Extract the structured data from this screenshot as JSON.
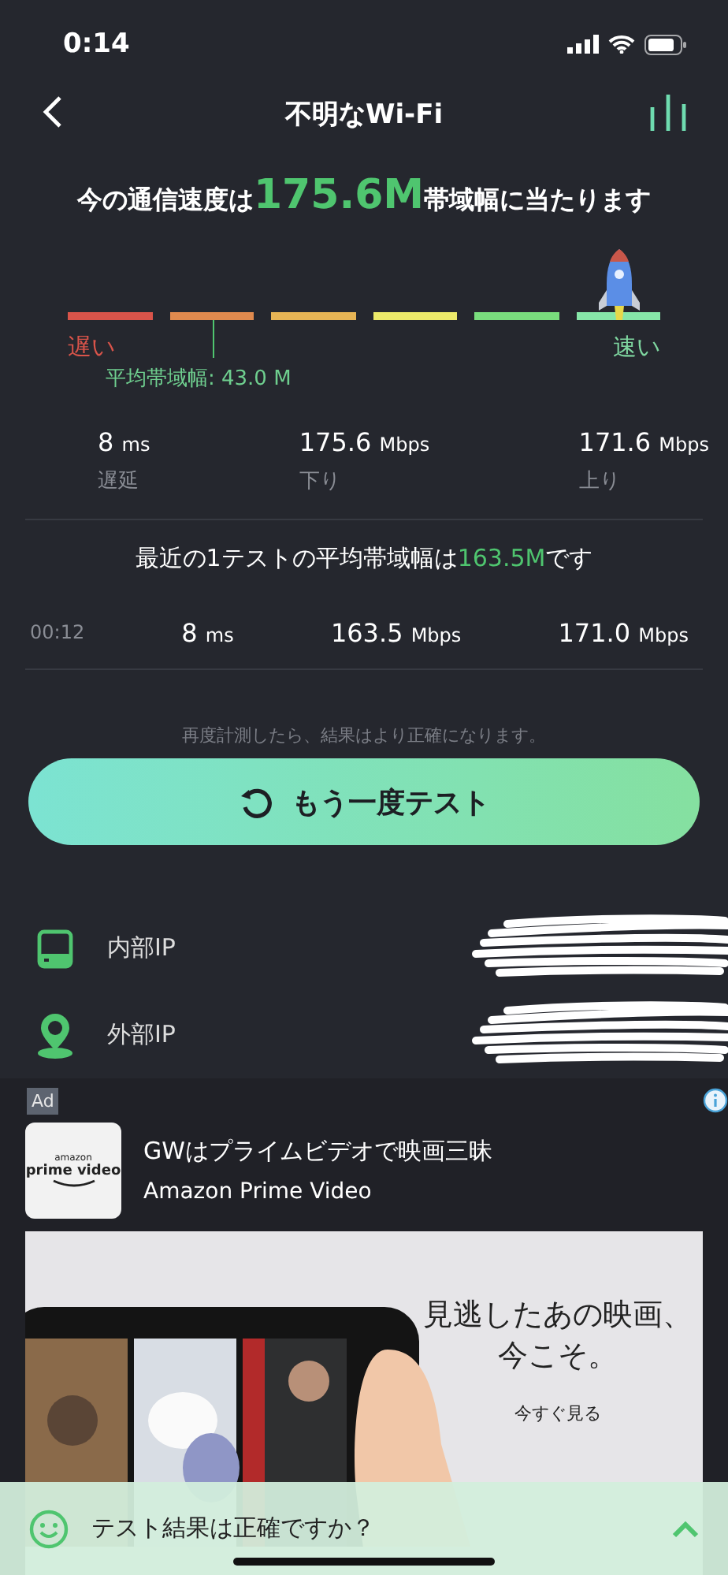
{
  "status_bar": {
    "time": "0:14"
  },
  "nav": {
    "title": "不明なWi-Fi"
  },
  "headline": {
    "before": "今の通信速度は",
    "value": "175.6M",
    "after": "帯域幅に当たります"
  },
  "meter": {
    "segments": [
      {
        "color": "#d9544a"
      },
      {
        "color": "#e08a4e"
      },
      {
        "color": "#e6b455"
      },
      {
        "color": "#ecea6a"
      },
      {
        "color": "#79dd7d"
      },
      {
        "color": "#86e6a8"
      }
    ],
    "slow_label": "遅い",
    "fast_label": "速い",
    "average": {
      "label": "平均帯域幅: 43.0 M"
    }
  },
  "stats": [
    {
      "value": "8",
      "unit": "ms",
      "label": "遅延"
    },
    {
      "value": "175.6",
      "unit": "Mbps",
      "label": "下り"
    },
    {
      "value": "171.6",
      "unit": "Mbps",
      "label": "上り"
    }
  ],
  "recent": {
    "before": "最近の1テストの平均帯域幅は",
    "value": "163.5M",
    "after": "です",
    "rows": [
      {
        "time": "00:12",
        "values": [
          {
            "value": "8",
            "unit": "ms"
          },
          {
            "value": "163.5",
            "unit": "Mbps"
          },
          {
            "value": "171.0",
            "unit": "Mbps"
          }
        ]
      }
    ]
  },
  "note": "再度計測したら、結果はより正確になります。",
  "retest_button": "もう一度テスト",
  "ip_rows": [
    {
      "kind": "internal",
      "label": "内部IP"
    },
    {
      "kind": "external",
      "label": "外部IP"
    }
  ],
  "ad": {
    "badge": "Ad",
    "logo_top": "amazon",
    "logo_text": "prime video",
    "title": "GWはプライムビデオで映画三昧",
    "advertiser": "Amazon Prime Video",
    "banner": {
      "headline": "見逃したあの映画、今こそ。",
      "cta": "今すぐ見る"
    }
  },
  "feedback": {
    "question": "テスト結果は正確ですか？"
  }
}
